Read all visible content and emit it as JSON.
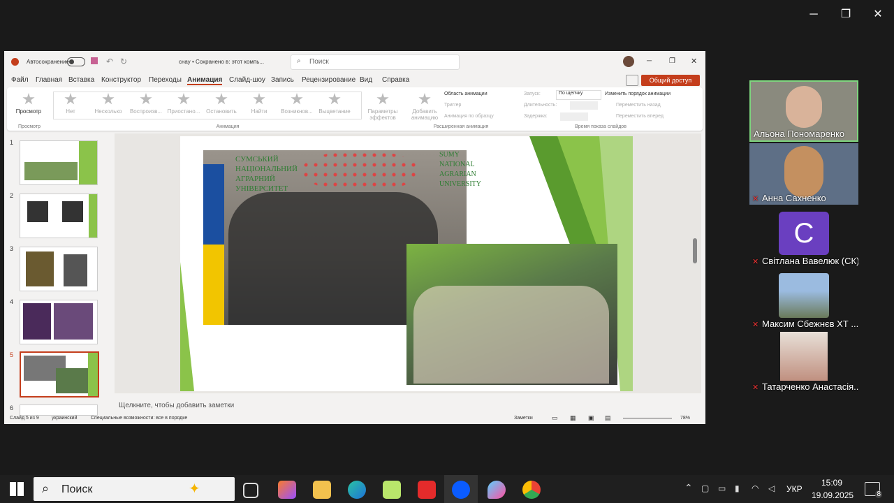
{
  "zoom": {
    "minimize": "─",
    "restore": "❐",
    "close": "✕"
  },
  "ppt": {
    "autosave": "Автосохранение",
    "doc_title": "снау • Сохранено в: этот компь...",
    "search_placeholder": "Поиск",
    "share": "Общий доступ",
    "menu": [
      "Файл",
      "Главная",
      "Вставка",
      "Конструктор",
      "Переходы",
      "Анимация",
      "Слайд-шоу",
      "Запись",
      "Рецензирование",
      "Вид",
      "Справка"
    ],
    "ribbon": {
      "preview": "Просмотр",
      "preview_group": "Просмотр",
      "animations": [
        "Нет",
        "Несколько",
        "Воспроизв...",
        "Приостано...",
        "Остановить",
        "Найти",
        "Возникнов...",
        "Выцветание"
      ],
      "anim_group": "Анимация",
      "effect_params": "Параметры эффектов",
      "add_anim": "Добавить анимацию",
      "anim_pane": "Область анимации",
      "trigger": "Триггер",
      "anim_painter": "Анимация по образцу",
      "advanced_group": "Расширенная анимация",
      "start_label": "Запуск:",
      "start_value": "По щелчку",
      "duration_label": "Длительность:",
      "delay_label": "Задержка:",
      "timing_group": "Время показа слайдов",
      "reorder": "Изменить порядок анимации",
      "move_back": "Переместить назад",
      "move_fwd": "Переместить вперед"
    },
    "slide_nums": [
      "1",
      "2",
      "3",
      "4",
      "5",
      "6"
    ],
    "slide_text": {
      "ua": "СУМСЬКИЙ НАЦІОНАЛЬНИЙ АГРАРНИЙ УНІВЕРСИТЕТ",
      "en": "SUMY NATIONAL AGRARIAN UNIVERSITY"
    },
    "notes": "Щелкните, чтобы добавить заметки",
    "status": {
      "slide": "Слайд 5 из 9",
      "lang": "украинский",
      "access": "Специальные возможности: все в порядке",
      "notes_btn": "Заметки",
      "zoom": "78%"
    }
  },
  "participants": [
    {
      "name": "Альона Пономаренко",
      "muted": false
    },
    {
      "name": "Анна Сахненко",
      "muted": true
    },
    {
      "name": "Світлана Вавелюк (СК)",
      "muted": true,
      "initial": "C"
    },
    {
      "name": "Максим Сбежнєв ХТ ...",
      "muted": true
    },
    {
      "name": "Татарченко Анастасія...",
      "muted": true
    }
  ],
  "taskbar": {
    "search": "Поиск",
    "lang": "УКР",
    "time": "15:09",
    "date": "19.09.2025",
    "notif": "8"
  },
  "colors": {
    "green": "#8bc34a",
    "dark_green": "#5a9b2e",
    "ppt_red": "#c43e1c",
    "zoom_blue": "#0b5cff",
    "active_border": "#7fd67f"
  }
}
